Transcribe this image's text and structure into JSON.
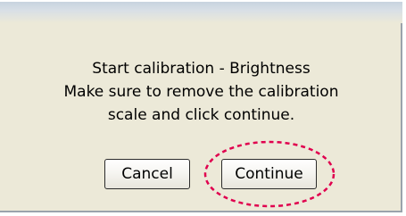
{
  "dialog": {
    "message_lines": [
      "Start calibration - Brightness",
      "Make sure to remove the calibration",
      "scale and click continue."
    ],
    "buttons": {
      "cancel_label": "Cancel",
      "continue_label": "Continue"
    }
  },
  "annotation": {
    "color": "#e0004e",
    "target": "Continue"
  },
  "colors": {
    "dialog_background": "#ece9d8",
    "text": "#000000"
  }
}
